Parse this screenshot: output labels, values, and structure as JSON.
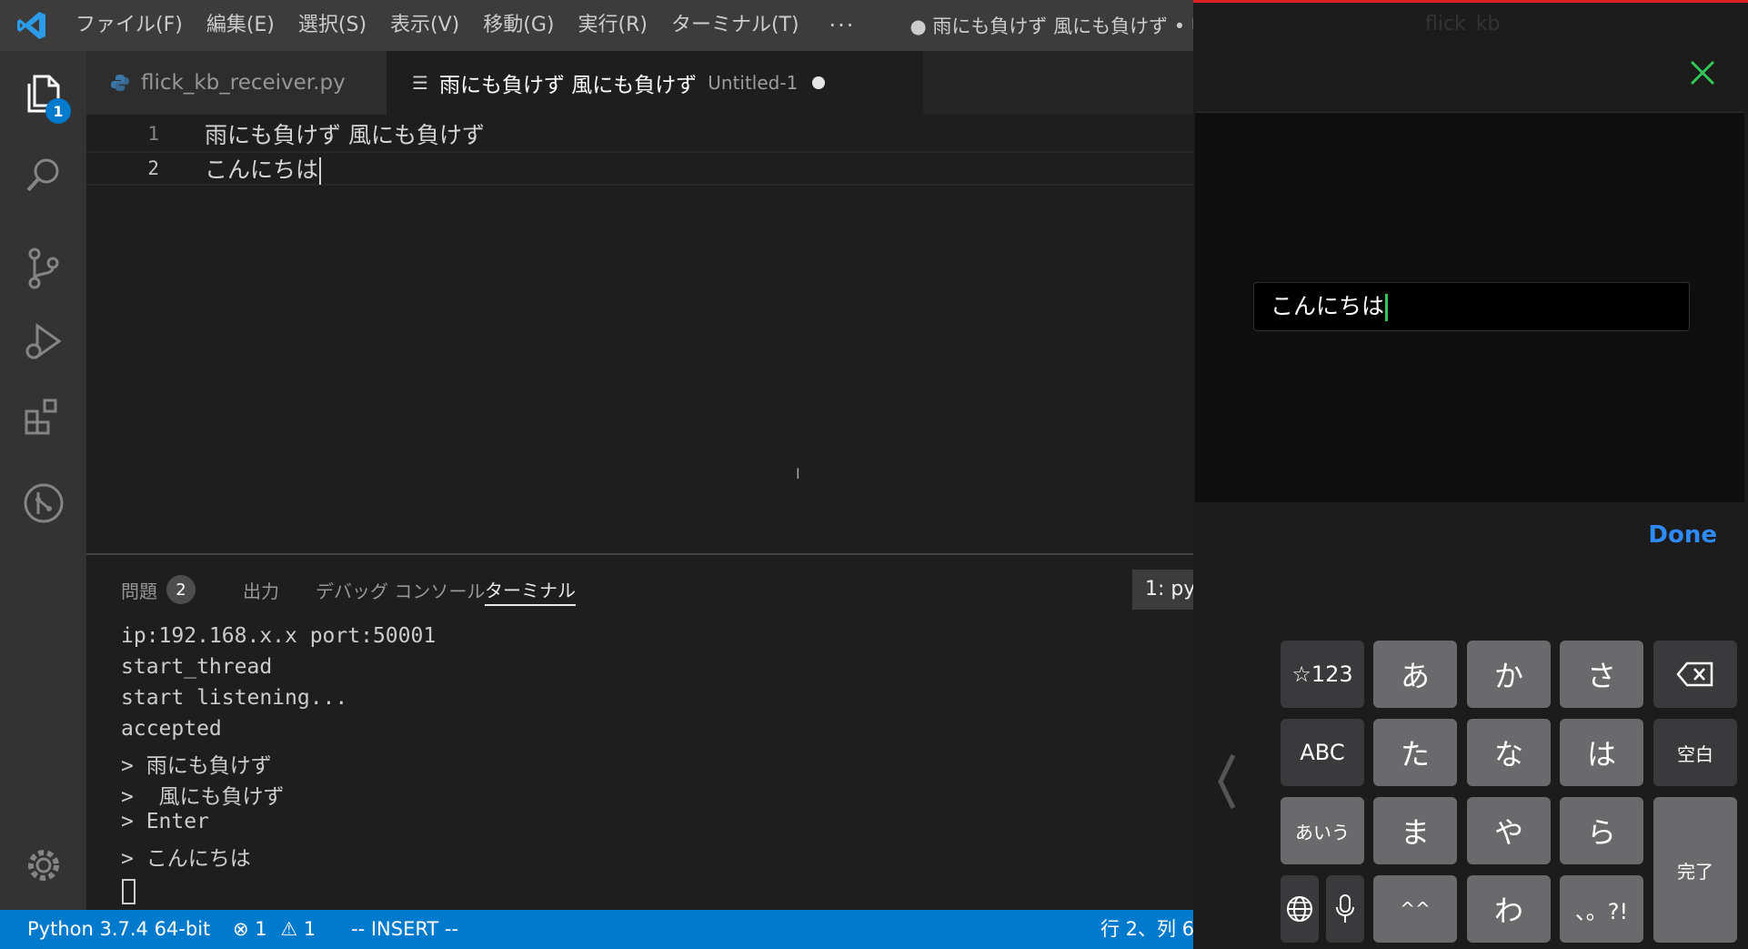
{
  "vscode": {
    "menu": [
      "ファイル(F)",
      "編集(E)",
      "選択(S)",
      "表示(V)",
      "移動(G)",
      "実行(R)",
      "ターミナル(T)"
    ],
    "menu_more": "···",
    "window_title": "● 雨にも負けず 風にも負けず • U",
    "explorer_badge": "1",
    "tabs": [
      {
        "label": "flick_kb_receiver.py",
        "icon": "python-icon"
      },
      {
        "label": "雨にも負けず 風にも負けず",
        "description": "Untitled-1",
        "icon": "text-file-icon"
      }
    ],
    "editor": {
      "lines": [
        {
          "number": "1",
          "text": "雨にも負けず 風にも負けず"
        },
        {
          "number": "2",
          "text": "こんにちは"
        }
      ]
    },
    "panel": {
      "tabs": {
        "problems": "問題",
        "problems_count": "2",
        "output": "出力",
        "debug_console": "デバッグ コンソール",
        "terminal": "ターミナル"
      },
      "terminal_selector": "1: py",
      "terminal_lines": [
        "ip:192.168.x.x port:50001",
        "start_thread",
        "start listening...",
        "accepted",
        "> 雨にも負けず",
        ">  風にも負けず",
        "> Enter",
        "> こんにちは"
      ]
    },
    "statusbar": {
      "python": "Python 3.7.4 64-bit",
      "errors": "1",
      "warnings": "1",
      "mode": "-- INSERT --",
      "position": "行 2、列 6"
    },
    "colors": {
      "statusbar": "#007acc",
      "editor_bg": "#1e1e1e",
      "titlebar": "#3c3c3c"
    }
  },
  "phone": {
    "title_ghost": "flick_kb",
    "input_value": "こんにちは",
    "done_label": "Done",
    "keyboard": {
      "row1": [
        "☆123",
        "あ",
        "か",
        "さ"
      ],
      "row2": [
        "ABC",
        "た",
        "な",
        "は",
        "空白"
      ],
      "row3": [
        "あいう",
        "ま",
        "や",
        "ら"
      ],
      "row4": [
        "^^",
        "わ",
        "、。?!"
      ],
      "confirm": "完了"
    },
    "colors": {
      "done": "#2f8af5",
      "caret": "#34c759",
      "close": "#34c759"
    }
  }
}
